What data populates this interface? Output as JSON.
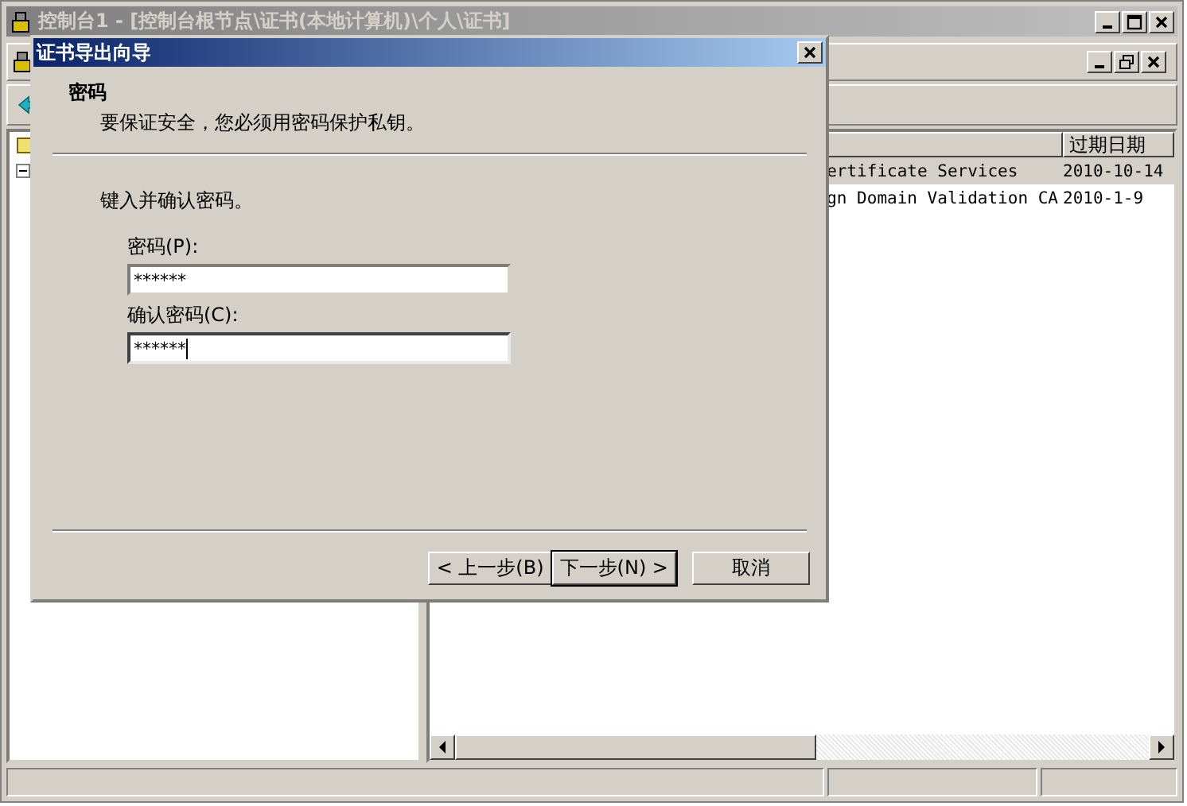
{
  "window": {
    "title": "控制台1 - [控制台根节点\\证书(本地计算机)\\个人\\证书]"
  },
  "list": {
    "column_2_header": "过期日期",
    "rows": [
      {
        "column_1": "ertificate Services",
        "column_2": "2010-10-14",
        "selected": true
      },
      {
        "column_1": "gn Domain Validation CA",
        "column_2": "2010-1-9",
        "selected": false
      }
    ]
  },
  "dialog": {
    "title": "证书导出向导",
    "header": {
      "title": "密码",
      "subtitle": "要保证安全，您必须用密码保护私钥。"
    },
    "instruction": "键入并确认密码。",
    "fields": [
      {
        "label": "密码(P):",
        "value": "******",
        "focused": false
      },
      {
        "label": "确认密码(C):",
        "value": "******",
        "focused": true
      }
    ],
    "buttons": [
      {
        "label": "< 上一步(B)",
        "default": false
      },
      {
        "label": "下一步(N) >",
        "default": true
      },
      {
        "label": "取消",
        "default": false
      }
    ]
  }
}
